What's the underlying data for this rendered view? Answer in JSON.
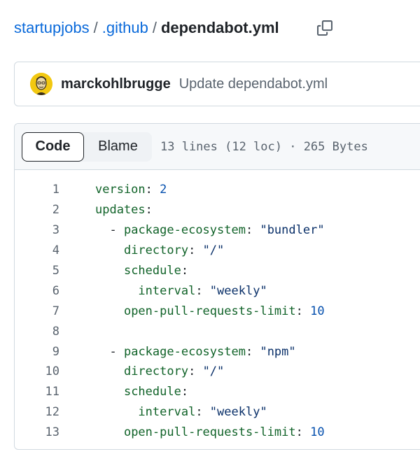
{
  "breadcrumb": {
    "repo": "startupjobs",
    "folder": ".github",
    "file": "dependabot.yml",
    "separator": "/"
  },
  "commit": {
    "author": "marckohlbrugge",
    "message": "Update dependabot.yml"
  },
  "file_header": {
    "tabs": [
      {
        "label": "Code",
        "active": true
      },
      {
        "label": "Blame",
        "active": false
      }
    ],
    "info": "13 lines (12 loc) · 265 Bytes"
  },
  "code_lines": [
    {
      "n": "1",
      "indent": "",
      "dash": "",
      "key": "version",
      "sep": ":",
      "value": " 2",
      "type": "n"
    },
    {
      "n": "2",
      "indent": "",
      "dash": "",
      "key": "updates",
      "sep": ":",
      "value": "",
      "type": ""
    },
    {
      "n": "3",
      "indent": "  ",
      "dash": "- ",
      "key": "package-ecosystem",
      "sep": ":",
      "value": " \"bundler\"",
      "type": "s"
    },
    {
      "n": "4",
      "indent": "    ",
      "dash": "",
      "key": "directory",
      "sep": ":",
      "value": " \"/\"",
      "type": "s"
    },
    {
      "n": "5",
      "indent": "    ",
      "dash": "",
      "key": "schedule",
      "sep": ":",
      "value": "",
      "type": ""
    },
    {
      "n": "6",
      "indent": "      ",
      "dash": "",
      "key": "interval",
      "sep": ":",
      "value": " \"weekly\"",
      "type": "s"
    },
    {
      "n": "7",
      "indent": "    ",
      "dash": "",
      "key": "open-pull-requests-limit",
      "sep": ":",
      "value": " 10",
      "type": "n"
    },
    {
      "n": "8",
      "indent": "",
      "dash": "",
      "key": "",
      "sep": "",
      "value": "",
      "type": ""
    },
    {
      "n": "9",
      "indent": "  ",
      "dash": "- ",
      "key": "package-ecosystem",
      "sep": ":",
      "value": " \"npm\"",
      "type": "s"
    },
    {
      "n": "10",
      "indent": "    ",
      "dash": "",
      "key": "directory",
      "sep": ":",
      "value": " \"/\"",
      "type": "s"
    },
    {
      "n": "11",
      "indent": "    ",
      "dash": "",
      "key": "schedule",
      "sep": ":",
      "value": "",
      "type": ""
    },
    {
      "n": "12",
      "indent": "      ",
      "dash": "",
      "key": "interval",
      "sep": ":",
      "value": " \"weekly\"",
      "type": "s"
    },
    {
      "n": "13",
      "indent": "    ",
      "dash": "",
      "key": "open-pull-requests-limit",
      "sep": ":",
      "value": " 10",
      "type": "n"
    }
  ],
  "icons": {
    "copy": "copy-icon",
    "avatar": "avatar"
  },
  "colors": {
    "link": "#0969da",
    "yaml_key": "#116329",
    "yaml_string": "#0a3069",
    "yaml_number": "#0550ae",
    "muted": "#59636e"
  }
}
